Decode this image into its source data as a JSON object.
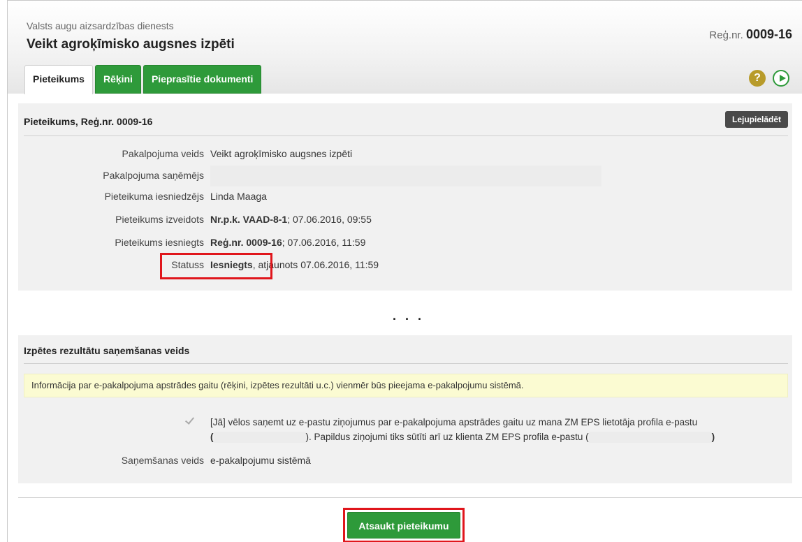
{
  "header": {
    "organization": "Valsts augu aizsardzības dienests",
    "title": "Veikt agroķīmisko augsnes izpēti",
    "reg_label": "Reģ.nr.",
    "reg_number": "0009-16"
  },
  "tabs": [
    {
      "label": "Pieteikums",
      "active": true
    },
    {
      "label": "Rēķini",
      "active": false
    },
    {
      "label": "Pieprasītie dokumenti",
      "active": false
    }
  ],
  "icons": {
    "help": "question-icon",
    "play": "play-icon",
    "help_glyph": "?"
  },
  "application_panel": {
    "title": "Pieteikums, Reģ.nr. 0009-16",
    "download_label": "Lejupielādēt",
    "fields": {
      "service_type": {
        "label": "Pakalpojuma veids",
        "value": "Veikt agroķīmisko augsnes izpēti"
      },
      "recipient": {
        "label": "Pakalpojuma saņēmējs",
        "value": ""
      },
      "submitter": {
        "label": "Pieteikuma iesniedzējs",
        "value": "Linda Maaga"
      },
      "created": {
        "label": "Pieteikums izveidots",
        "bold": "Nr.p.k. VAAD-8-1",
        "rest": "; 07.06.2016, 09:55"
      },
      "submitted": {
        "label": "Pieteikums iesniegts",
        "bold": "Reģ.nr. 0009-16",
        "rest": "; 07.06.2016, 11:59"
      },
      "status": {
        "label": "Statuss",
        "bold": "Iesniegts",
        "rest": ", atjaunots 07.06.2016, 11:59"
      }
    }
  },
  "ellipsis": ". . .",
  "results_panel": {
    "title": "Izpētes rezultātu saņemšanas veids",
    "info": "Informācija par e-pakalpojuma apstrādes gaitu (rēķini, izpētes rezultāti u.c.) vienmēr būs pieejama e-pakalpojumu sistēmā.",
    "consent_checked": true,
    "consent_part1": "[Jā] vēlos saņemt uz e-pastu ziņojumus par e-pakalpojuma apstrādes gaitu uz mana ZM EPS lietotāja profila e-pastu",
    "open_paren": "(",
    "consent_part2": "). Papildus ziņojumi tiks sūtīti arī uz klienta ZM EPS profila e-pastu (",
    "close_paren": ")",
    "receive_label": "Saņemšanas veids",
    "receive_value": "e-pakalpojumu sistēmā"
  },
  "actions": {
    "cancel_label": "Atsaukt pieteikumu"
  },
  "colors": {
    "accent_green": "#2e9a3a",
    "highlight_red": "#e0161c",
    "info_yellow": "#fbfbd2"
  }
}
